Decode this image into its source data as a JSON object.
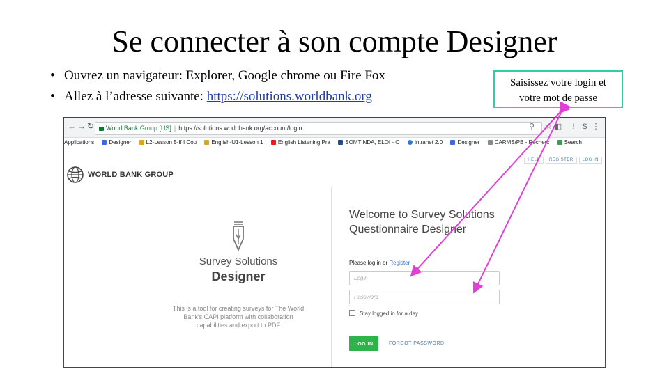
{
  "slide": {
    "title": "Se connecter à son compte Designer",
    "bullet1": "Ouvrez un navigateur: Explorer, Google chrome ou Fire Fox",
    "bullet2_prefix": "Allez à l’adresse suivante: ",
    "bullet2_link": "https://solutions.worldbank.org",
    "callout_line1": "Saisissez votre login et",
    "callout_line2": "votre mot de passe",
    "callout_border_color": "#2ecfa6",
    "arrow_color": "#e03fd8"
  },
  "browser": {
    "site_name": "World Bank Group [US]",
    "url": "https://solutions.worldbank.org/account/login",
    "nav_icons": [
      "back-icon",
      "forward-icon",
      "reload-icon"
    ],
    "bookmarks": [
      "Applications",
      "Designer",
      "L2-Lesson 5-If I Cou",
      "English-U1-Lesson 1",
      "English Listening Pra",
      "SOMTINDA, ELOI - O",
      "Intranet 2.0",
      "Designer",
      "DARMS/PB - Recherc",
      "Search"
    ]
  },
  "page": {
    "logo_text": "WORLD BANK GROUP",
    "top_links": [
      "HELP",
      "REGISTER",
      "LOG IN"
    ],
    "product_name": "Survey Solutions",
    "product_sub": "Designer",
    "description": "This is a tool for creating surveys for The World Bank's CAPI platform with collaboration capabilities and export to PDF",
    "welcome_line1": "Welcome to Survey Solutions",
    "welcome_line2": "Questionnaire Designer",
    "please_text": "Please log in or ",
    "register_link": "Register",
    "login_placeholder": "Login",
    "password_placeholder": "Password",
    "stay_logged": "Stay logged in for a day",
    "login_button": "LOG IN",
    "forgot_link": "FORGOT PASSWORD",
    "accent_color": "#2db34a"
  }
}
